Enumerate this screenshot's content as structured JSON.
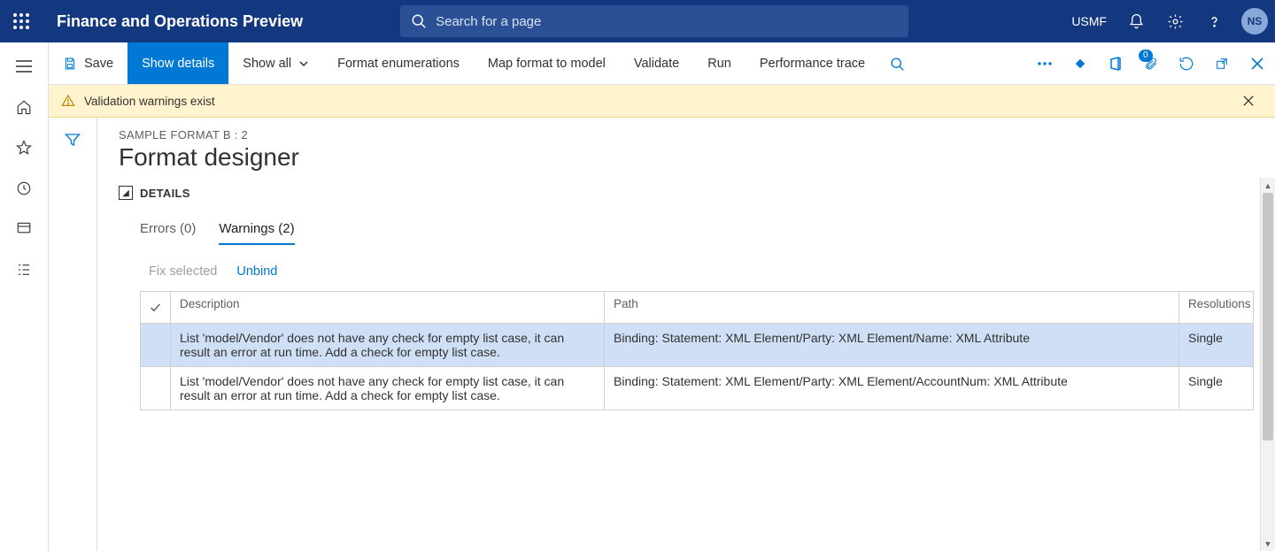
{
  "header": {
    "app_title": "Finance and Operations Preview",
    "search_placeholder": "Search for a page",
    "company": "USMF",
    "avatar_initials": "NS"
  },
  "actionbar": {
    "save": "Save",
    "show_details": "Show details",
    "show_all": "Show all",
    "format_enum": "Format enumerations",
    "map_format": "Map format to model",
    "validate": "Validate",
    "run": "Run",
    "perf_trace": "Performance trace",
    "attach_badge": "0"
  },
  "banner": {
    "text": "Validation warnings exist"
  },
  "page": {
    "breadcrumb": "SAMPLE FORMAT B : 2",
    "title": "Format designer",
    "details_label": "DETAILS"
  },
  "tabs": {
    "errors": "Errors (0)",
    "warnings": "Warnings (2)"
  },
  "subactions": {
    "fix": "Fix selected",
    "unbind": "Unbind"
  },
  "table": {
    "headers": {
      "description": "Description",
      "path": "Path",
      "resolutions": "Resolutions"
    },
    "rows": [
      {
        "description": "List 'model/Vendor' does not have any check for empty list case, it can result an error at run time. Add a check for empty list case.",
        "path": "Binding: Statement: XML Element/Party: XML Element/Name: XML Attribute",
        "resolutions": "Single",
        "selected": true
      },
      {
        "description": "List 'model/Vendor' does not have any check for empty list case, it can result an error at run time. Add a check for empty list case.",
        "path": "Binding: Statement: XML Element/Party: XML Element/AccountNum: XML Attribute",
        "resolutions": "Single",
        "selected": false
      }
    ]
  }
}
